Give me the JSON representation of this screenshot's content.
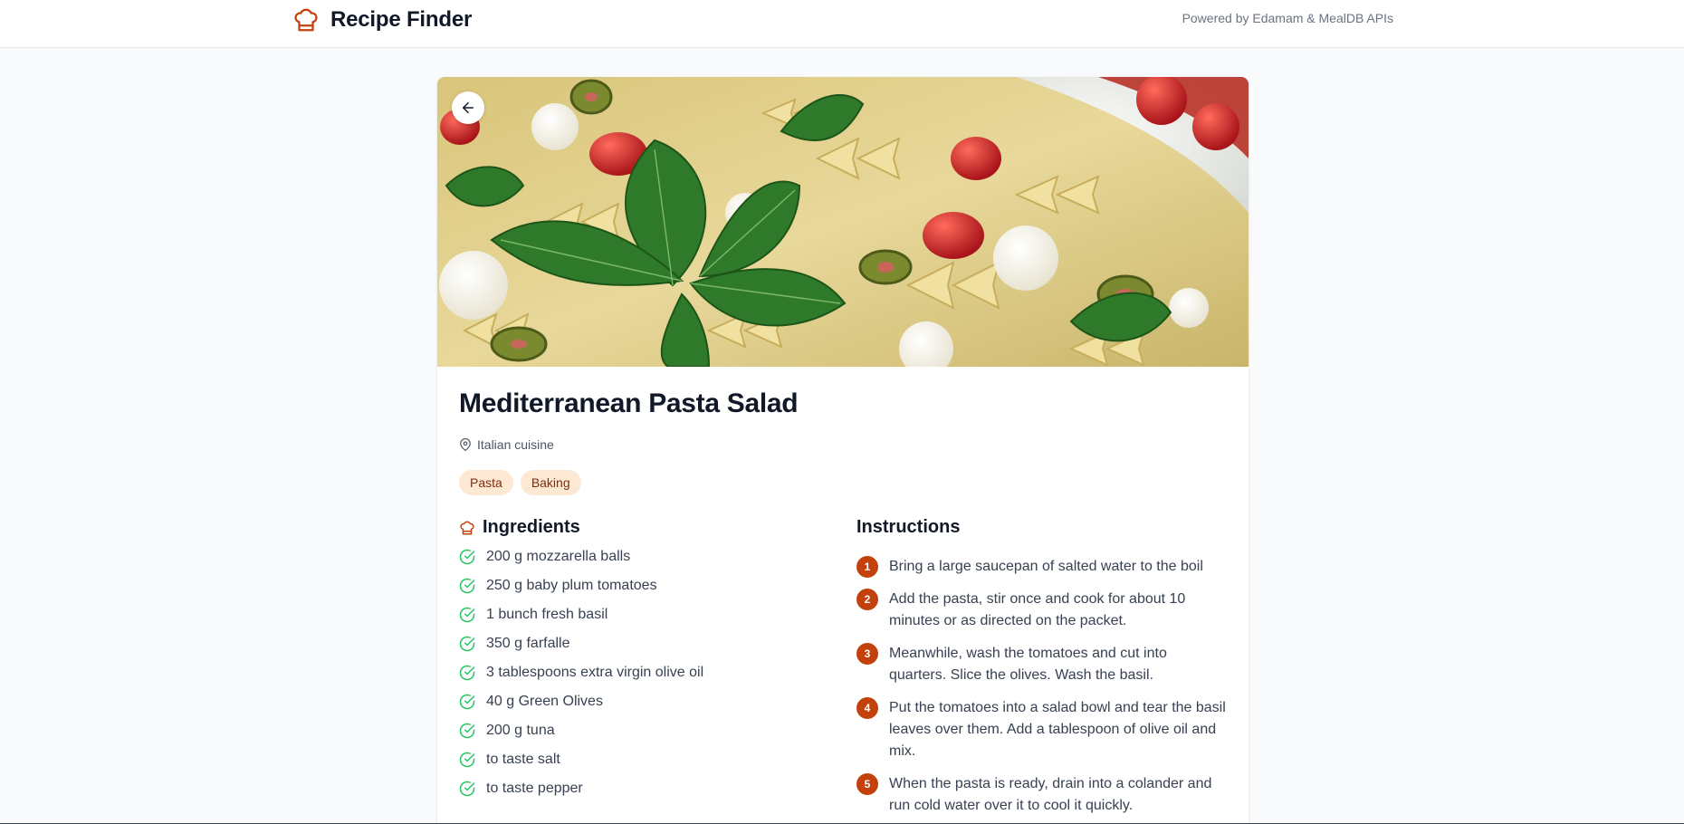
{
  "header": {
    "app_title": "Recipe Finder",
    "powered_by": "Powered by Edamam & MealDB APIs",
    "logo_icon": "chef-hat-icon",
    "accent_color": "#c2410c"
  },
  "recipe": {
    "title": "Mediterranean Pasta Salad",
    "image_alt": "Mediterranean Pasta Salad",
    "cuisine": "Italian cuisine",
    "tags": [
      "Pasta",
      "Baking"
    ],
    "back_icon": "arrow-left-icon"
  },
  "ingredients": {
    "heading": "Ingredients",
    "items": [
      "200 g mozzarella balls",
      "250 g baby plum tomatoes",
      "1 bunch fresh basil",
      "350 g farfalle",
      "3 tablespoons extra virgin olive oil",
      "40 g Green Olives",
      "200 g tuna",
      "to taste salt",
      "to taste pepper"
    ]
  },
  "instructions": {
    "heading": "Instructions",
    "steps": [
      {
        "num": "1",
        "text": "Bring a large saucepan of salted water to the boil"
      },
      {
        "num": "2",
        "text": "Add the pasta, stir once and cook for about 10 minutes or as directed on the packet."
      },
      {
        "num": "3",
        "text": "Meanwhile, wash the tomatoes and cut into quarters. Slice the olives. Wash the basil."
      },
      {
        "num": "4",
        "text": "Put the tomatoes into a salad bowl and tear the basil leaves over them. Add a tablespoon of olive oil and mix."
      },
      {
        "num": "5",
        "text": "When the pasta is ready, drain into a colander and run cold water over it to cool it quickly."
      }
    ]
  }
}
